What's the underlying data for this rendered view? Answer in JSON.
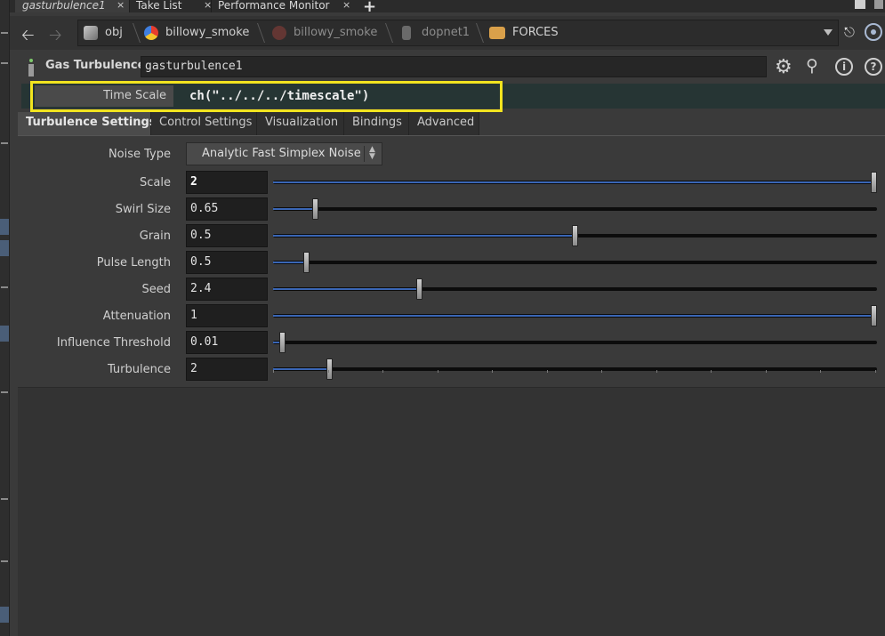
{
  "tabs": [
    {
      "label": "gasturbulence1",
      "active": true
    },
    {
      "label": "Take List",
      "active": false
    },
    {
      "label": "Performance Monitor",
      "active": false
    }
  ],
  "tab_close_glyph": "×",
  "tab_add_glyph": "+",
  "path": {
    "crumbs": [
      {
        "label": "obj",
        "icon": "obj-network-icon",
        "dim": false
      },
      {
        "label": "billowy_smoke",
        "icon": "geometry-node-icon",
        "dim": false
      },
      {
        "label": "billowy_smoke",
        "icon": "dop-network-icon",
        "dim": true
      },
      {
        "label": "dopnet1",
        "icon": "dopnet-icon",
        "dim": true
      },
      {
        "label": "FORCES",
        "icon": "folder-icon",
        "dim": false
      }
    ]
  },
  "node": {
    "type_label": "Gas Turbulence",
    "name": "gasturbulence1"
  },
  "time_scale": {
    "label": "Time Scale",
    "expression": "ch(\"../../../timescale\")"
  },
  "folder_tabs": [
    {
      "label": "Turbulence Settings",
      "active": true
    },
    {
      "label": "Control Settings",
      "active": false
    },
    {
      "label": "Visualization",
      "active": false
    },
    {
      "label": "Bindings",
      "active": false
    },
    {
      "label": "Advanced",
      "active": false
    }
  ],
  "noise_type": {
    "label": "Noise Type",
    "value": "Analytic Fast Simplex Noise"
  },
  "params": [
    {
      "label": "Scale",
      "value": "2",
      "slider_fraction": 1.0,
      "bold": true
    },
    {
      "label": "Swirl Size",
      "value": "0.65",
      "slider_fraction": 0.065,
      "bold": false
    },
    {
      "label": "Grain",
      "value": "0.5",
      "slider_fraction": 0.5,
      "bold": false
    },
    {
      "label": "Pulse Length",
      "value": "0.5",
      "slider_fraction": 0.05,
      "bold": false
    },
    {
      "label": "Seed",
      "value": "2.4",
      "slider_fraction": 0.24,
      "bold": false
    },
    {
      "label": "Attenuation",
      "value": "1",
      "slider_fraction": 1.0,
      "bold": false
    },
    {
      "label": "Influence Threshold",
      "value": "0.01",
      "slider_fraction": 0.01,
      "bold": false
    },
    {
      "label": "Turbulence",
      "value": "2",
      "slider_fraction": 0.09,
      "bold": false
    }
  ],
  "colors": {
    "accent_highlight": "#f2e41f",
    "slider_fill": "#3a66b5",
    "expression_bg": "#263534"
  }
}
